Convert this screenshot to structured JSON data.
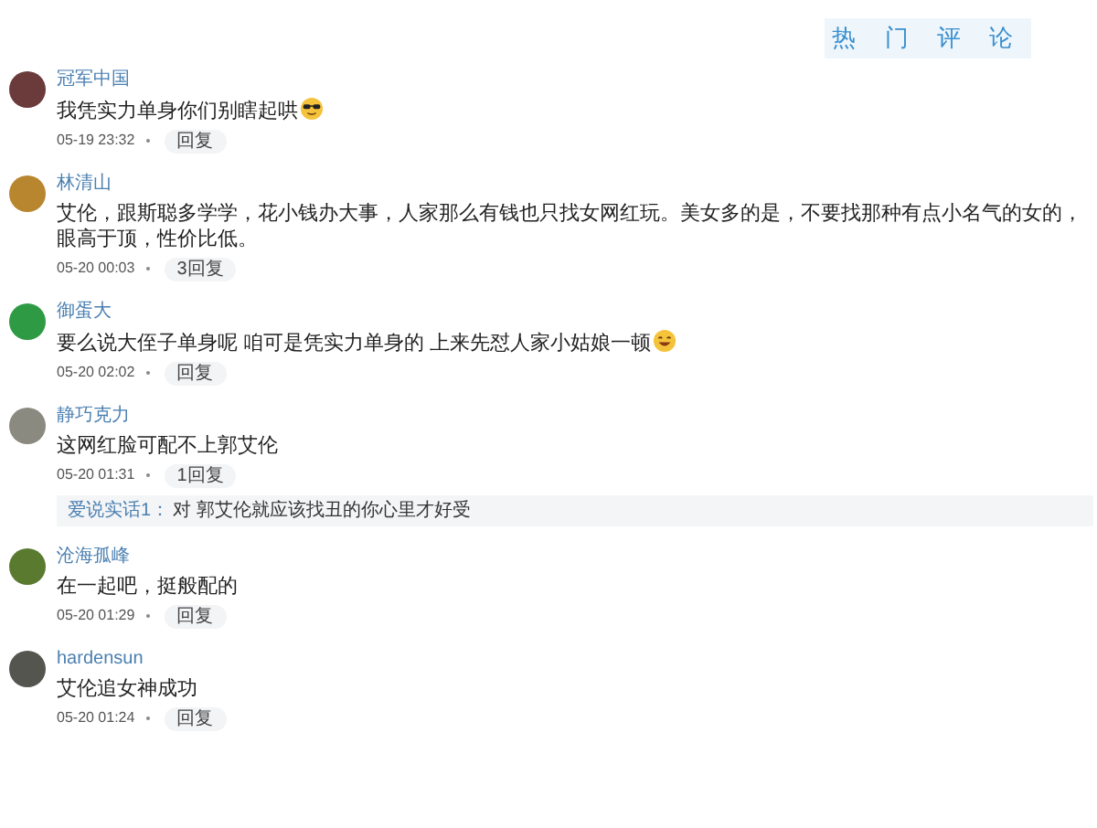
{
  "heading": "热 门 评 论",
  "comments": [
    {
      "user": "冠军中国",
      "color": "#6b3a3a",
      "text": "我凭实力单身你们别瞎起哄",
      "kind": "sunglasses",
      "time": "05-19 23:32",
      "reply": "回复"
    },
    {
      "user": "林清山",
      "color": "#b8862e",
      "text": "艾伦，跟斯聪多学学，花小钱办大事，人家那么有钱也只找女网红玩。美女多的是，不要找那种有点小名气的女的，眼高于顶，性价比低。",
      "time": "05-20 00:03",
      "reply": "3回复"
    },
    {
      "user": "御蛋大",
      "color": "#2e9a44",
      "text": "要么说大侄子单身呢 咱可是凭实力单身的 上来先怼人家小姑娘一顿",
      "kind": "grin",
      "time": "05-20 02:02",
      "reply": "回复"
    },
    {
      "user": "静巧克力",
      "color": "#8a8a80",
      "text": "这网红脸可配不上郭艾伦",
      "time": "05-20 01:31",
      "reply": "1回复",
      "sub_reply": {
        "user": "爱说实话1：",
        "text": "对 郭艾伦就应该找丑的你心里才好受"
      }
    },
    {
      "user": "沧海孤峰",
      "color": "#5a7a30",
      "text": "在一起吧，挺般配的",
      "time": "05-20 01:29",
      "reply": "回复"
    },
    {
      "user": "hardensun",
      "color": "#555550",
      "text": "艾伦追女神成功",
      "time": "05-20 01:24",
      "reply": "回复"
    }
  ]
}
